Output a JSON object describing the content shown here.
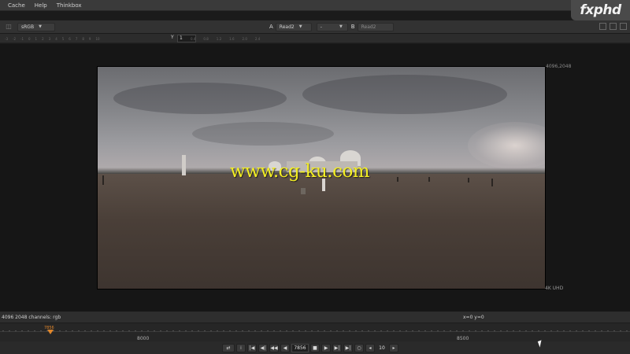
{
  "menu": {
    "items": [
      "Cache",
      "Help",
      "Thinkbox"
    ]
  },
  "logo": {
    "text": "fxphd"
  },
  "toolbar": {
    "colorspace": "sRGB",
    "input_a_tag": "A",
    "input_a": "Read2",
    "operation": "-",
    "input_b_tag": "B",
    "input_b": "Read2"
  },
  "ruler": {
    "y_label": "Y",
    "y_value": "1",
    "ticks_left": [
      "-3",
      "-2",
      "-1",
      "0",
      "1",
      "2",
      "3",
      "4",
      "5",
      "6",
      "7",
      "8",
      "9",
      "10"
    ],
    "ticks_right": [
      "0.4",
      "0.8",
      "1.2",
      "1.6",
      "2.0",
      "2.4"
    ]
  },
  "viewer": {
    "format_top": "4096,2048",
    "format_bottom": "4K UHD",
    "watermark": "www.cg-ku.com"
  },
  "info": {
    "left": "4096 2048 channels: rgb",
    "coords": "x=0 y=0"
  },
  "timeline": {
    "current_frame_label": "7856",
    "label_a": "8000",
    "label_b": "8500"
  },
  "controls": {
    "frame": "7856",
    "increment": "10"
  }
}
